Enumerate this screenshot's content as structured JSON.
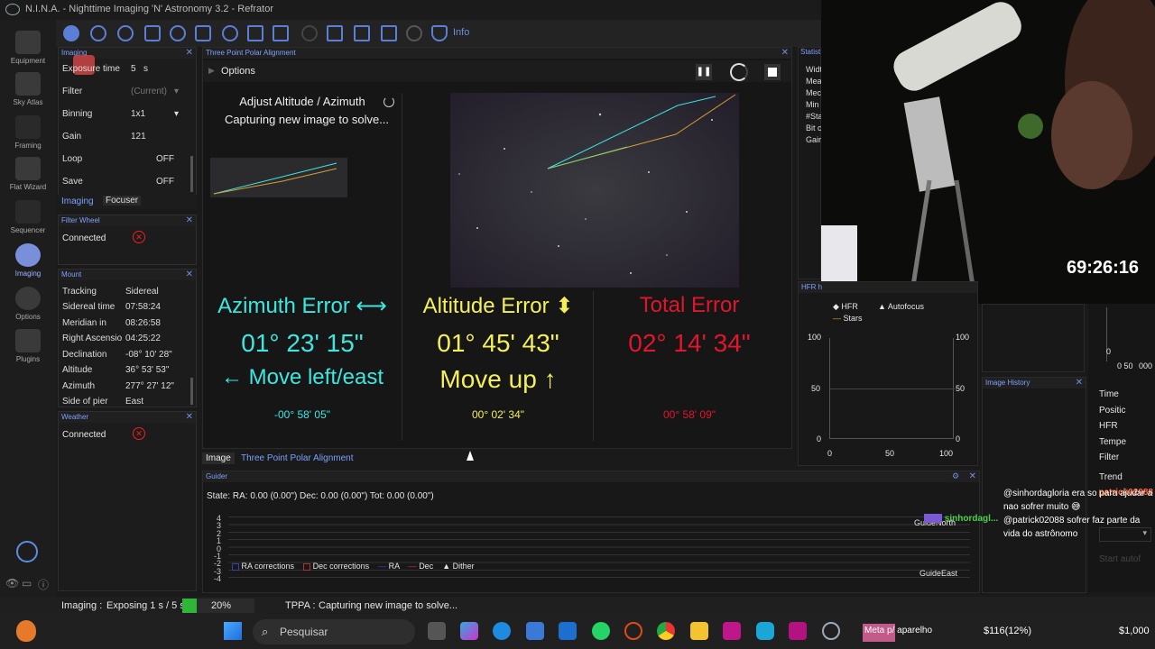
{
  "window": {
    "title": "N.I.N.A. - Nighttime Imaging 'N' Astronomy 3.2 - Refrator"
  },
  "nav": {
    "items": [
      {
        "label": "Equipment"
      },
      {
        "label": "Sky Atlas"
      },
      {
        "label": "Framing"
      },
      {
        "label": "Flat Wizard"
      },
      {
        "label": "Sequencer"
      },
      {
        "label": "Imaging"
      },
      {
        "label": "Options"
      },
      {
        "label": "Plugins"
      }
    ],
    "collapse": "< <"
  },
  "toolbar": {
    "info_label": "Info"
  },
  "imaging_panel": {
    "title": "Imaging",
    "rows": [
      {
        "label": "Exposure time",
        "value": "5",
        "unit": "s"
      },
      {
        "label": "Filter",
        "value": "(Current)"
      },
      {
        "label": "Binning",
        "value": "1x1"
      },
      {
        "label": "Gain",
        "value": "121"
      },
      {
        "label": "Loop",
        "value": "OFF"
      },
      {
        "label": "Save",
        "value": "OFF"
      }
    ],
    "tabs": [
      "Imaging",
      "Focuser"
    ]
  },
  "filter_wheel": {
    "title": "Filter Wheel",
    "status": "Connected"
  },
  "mount": {
    "title": "Mount",
    "rows": [
      {
        "label": "Tracking",
        "value": "Sidereal"
      },
      {
        "label": "Sidereal time",
        "value": "07:58:24"
      },
      {
        "label": "Meridian in",
        "value": "08:26:58"
      },
      {
        "label": "Right Ascension",
        "value": "04:25:22"
      },
      {
        "label": "Declination",
        "value": "-08° 10' 28\""
      },
      {
        "label": "Altitude",
        "value": "36° 53' 53\""
      },
      {
        "label": "Azimuth",
        "value": "277° 27' 12\""
      },
      {
        "label": "Side of pier",
        "value": "East"
      }
    ]
  },
  "weather": {
    "title": "Weather",
    "status": "Connected"
  },
  "tppa": {
    "title": "Three Point Polar Alignment",
    "options_label": "Options",
    "step_title": "Adjust Altitude / Azimuth",
    "step_status": "Capturing new image to solve...",
    "azimuth": {
      "heading": "Azimuth Error ⟷",
      "value": "01° 23' 15\"",
      "direction": "← Move left/east",
      "delta": "-00° 58' 05\""
    },
    "altitude": {
      "heading": "Altitude Error ⬍",
      "value": "01° 45' 43\"",
      "direction": "Move up ↑",
      "delta": "00° 02' 34\""
    },
    "total": {
      "heading": "Total Error",
      "value": "02° 14' 34\"",
      "delta": "00° 58' 09\""
    },
    "colors": {
      "azimuth": "#3ee6e0",
      "altitude": "#f4f05a",
      "total": "#e0172c"
    },
    "bottom_tabs": [
      "Image",
      "Three Point Polar Alignment"
    ]
  },
  "statistics": {
    "title": "Statist",
    "labels": [
      "Widt",
      "Mea",
      "Mec",
      "Min",
      "#Sta",
      "Bit c",
      "Gair"
    ]
  },
  "hfr_panel": {
    "title": "HFR h",
    "legend": [
      "HFR",
      "Autofocus",
      "Stars"
    ],
    "y_ticks_left": [
      "100",
      "50",
      "0"
    ],
    "y_ticks_right": [
      "100",
      "50",
      "0"
    ],
    "x_ticks": [
      "0",
      "50",
      "100"
    ]
  },
  "image_history": {
    "title": "Image History"
  },
  "right_column": {
    "axis_top": "0",
    "axis_bottom": "0 50",
    "axis_right": "000",
    "labels": [
      "Time",
      "Positic",
      "HFR",
      "Tempe",
      "Filter",
      "Trend"
    ],
    "start_button": "Start autof"
  },
  "guider": {
    "title": "Guider",
    "state": "State:  RA: 0.00 (0.00\")  Dec: 0.00 (0.00\")  Tot: 0.00 (0.00\")",
    "y_ticks": [
      "4",
      "3",
      "2",
      "1",
      "0",
      "-1",
      "-2",
      "-3",
      "-4"
    ],
    "legend": [
      "RA corrections",
      "Dec corrections",
      "RA",
      "Dec",
      "Dither"
    ],
    "north_label": "GuideNorth",
    "east_label": "GuideEast"
  },
  "chat": {
    "messages": [
      {
        "user": "patrick02088",
        "text": "@sinhordagloria era so para ajudar a nao sofrer muito 😅"
      },
      {
        "user": "sinhordagl...",
        "text": "@patrick02088 sofrer faz parte da vida do astrônomo"
      }
    ]
  },
  "webcam": {
    "timer": "69:26:16"
  },
  "statusbar": {
    "imaging_label": "Imaging :",
    "imaging_text": "Exposing 1 s / 5 s",
    "progress_fraction": 0.2,
    "progress_text": "20%",
    "tppa_label": "TPPA :",
    "tppa_text": "Capturing new image to solve..."
  },
  "taskbar": {
    "search_placeholder": "Pesquisar",
    "meta_label": "Meta p/ aparelho",
    "meta_amount": "$116(12%)",
    "meta_goal": "$1,000"
  }
}
